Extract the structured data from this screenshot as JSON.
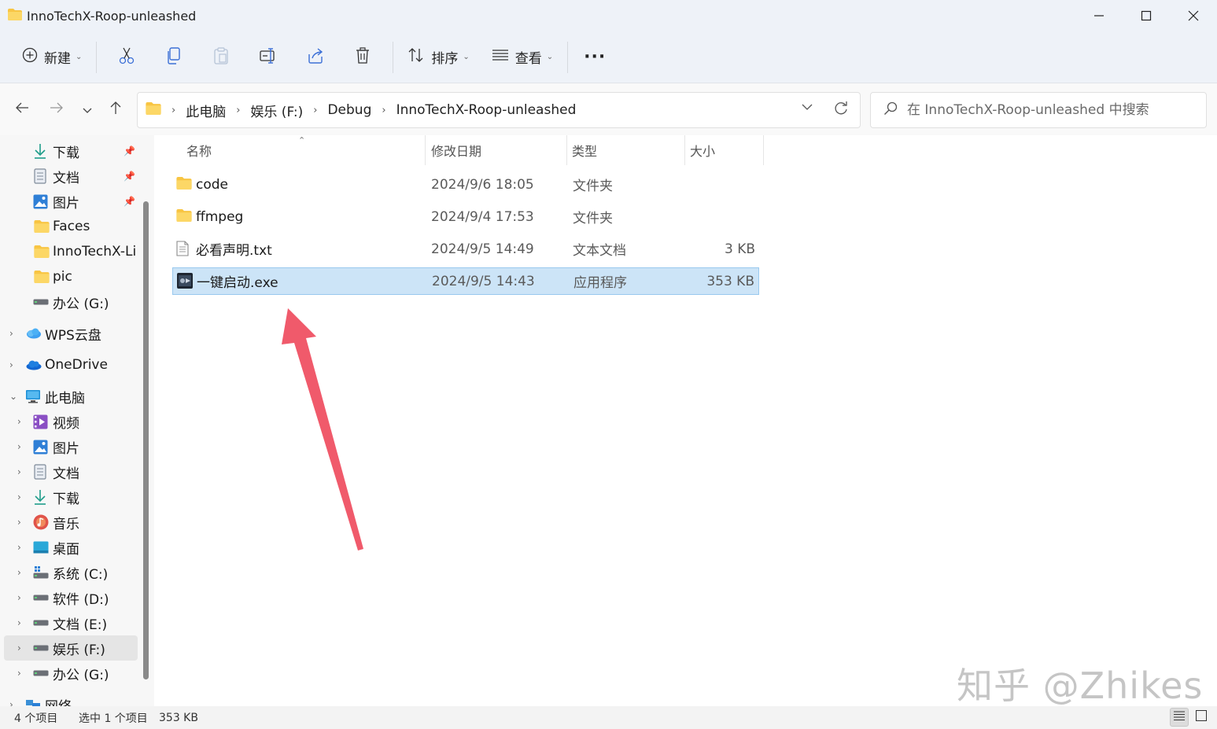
{
  "window": {
    "title": "InnoTechX-Roop-unleashed",
    "folder_icon": "folder-icon",
    "controls": [
      "minimize",
      "maximize",
      "close"
    ]
  },
  "toolbar": {
    "new_label": "新建",
    "sort_label": "排序",
    "view_label": "查看",
    "more_label": "···",
    "icons": [
      "cut-icon",
      "copy-icon",
      "paste-icon",
      "rename-icon",
      "share-icon",
      "delete-icon"
    ]
  },
  "address": {
    "crumbs": [
      "此电脑",
      "娱乐 (F:)",
      "Debug",
      "InnoTechX-Roop-unleashed"
    ],
    "search_placeholder": "在 InnoTechX-Roop-unleashed 中搜索"
  },
  "sidebar": {
    "quick": [
      {
        "label": "下载",
        "icon": "download-icon",
        "pinned": true
      },
      {
        "label": "文档",
        "icon": "document-icon",
        "pinned": true
      },
      {
        "label": "图片",
        "icon": "pictures-icon",
        "pinned": true
      },
      {
        "label": "Faces",
        "icon": "folder-icon"
      },
      {
        "label": "InnoTechX-Li",
        "icon": "folder-icon"
      },
      {
        "label": "pic",
        "icon": "folder-icon"
      },
      {
        "label": "办公 (G:)",
        "icon": "drive-icon"
      }
    ],
    "wps": "WPS云盘",
    "onedrive": "OneDrive",
    "thispc": "此电脑",
    "pc_items": [
      {
        "label": "视频",
        "icon": "video-icon"
      },
      {
        "label": "图片",
        "icon": "pictures-icon"
      },
      {
        "label": "文档",
        "icon": "document-icon"
      },
      {
        "label": "下载",
        "icon": "download-icon"
      },
      {
        "label": "音乐",
        "icon": "music-icon"
      },
      {
        "label": "桌面",
        "icon": "desktop-icon"
      },
      {
        "label": "系统 (C:)",
        "icon": "system-drive-icon"
      },
      {
        "label": "软件 (D:)",
        "icon": "drive-icon"
      },
      {
        "label": "文档 (E:)",
        "icon": "drive-icon"
      },
      {
        "label": "娱乐 (F:)",
        "icon": "drive-icon",
        "selected": true
      },
      {
        "label": "办公 (G:)",
        "icon": "drive-icon"
      }
    ],
    "network": "网络"
  },
  "columns": {
    "name": "名称",
    "modified": "修改日期",
    "type": "类型",
    "size": "大小"
  },
  "files": [
    {
      "name": "code",
      "modified": "2024/9/6 18:05",
      "type": "文件夹",
      "size": "",
      "icon": "folder-icon"
    },
    {
      "name": "ffmpeg",
      "modified": "2024/9/4 17:53",
      "type": "文件夹",
      "size": "",
      "icon": "folder-icon"
    },
    {
      "name": "必看声明.txt",
      "modified": "2024/9/5 14:49",
      "type": "文本文档",
      "size": "3 KB",
      "icon": "text-file-icon"
    },
    {
      "name": "一键启动.exe",
      "modified": "2024/9/5 14:43",
      "type": "应用程序",
      "size": "353 KB",
      "icon": "exe-icon",
      "selected": true
    }
  ],
  "status": {
    "count": "4 个项目",
    "selection": "选中 1 个项目",
    "size": "353 KB"
  },
  "watermark": "知乎 @Zhikes",
  "colors": {
    "selection_bg": "#cce4f7",
    "arrow": "#f05a6b",
    "folder": "#f8c543"
  }
}
